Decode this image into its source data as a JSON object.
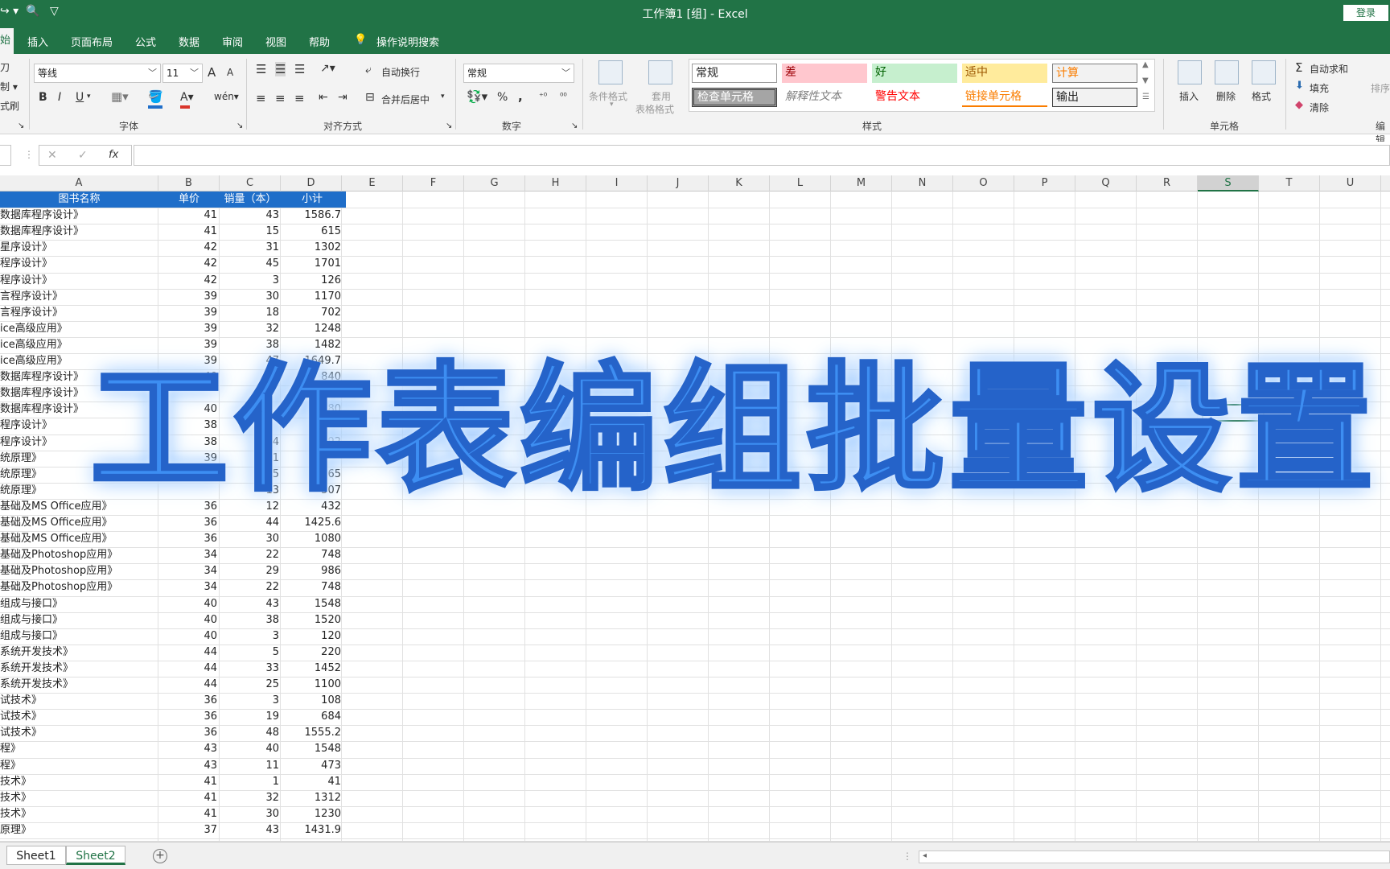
{
  "titlebar": {
    "title": "工作簿1  [组]  -  Excel",
    "login": "登录",
    "qat": [
      "↪ ▾",
      "🔍",
      "▽"
    ]
  },
  "tabs": {
    "home": "始",
    "items": [
      "插入",
      "页面布局",
      "公式",
      "数据",
      "审阅",
      "视图",
      "帮助"
    ],
    "search": "操作说明搜索"
  },
  "ribbon": {
    "clipboard": [
      "刀",
      "制 ▾",
      "式刷"
    ],
    "font": {
      "name": "等线",
      "size": "11",
      "grow": "A",
      "shrink": "A",
      "bold": "B",
      "italic": "I",
      "underline": "U",
      "label": "字体"
    },
    "alignment": {
      "wrap": "自动换行",
      "merge": "合并后居中",
      "label": "对齐方式"
    },
    "number": {
      "format": "常规",
      "percent": "%",
      "comma": ",",
      "label": "数字"
    },
    "conditional": "条件格式",
    "table_format_1": "套用",
    "table_format_2": "表格格式",
    "styles": {
      "normal": "常规",
      "bad": "差",
      "good": "好",
      "neutral": "适中",
      "calc": "计算",
      "check": "检查单元格",
      "explain": "解释性文本",
      "warn": "警告文本",
      "link": "链接单元格",
      "output": "输出",
      "label": "样式"
    },
    "cells": {
      "insert": "插入",
      "delete": "删除",
      "format": "格式",
      "label": "单元格"
    },
    "editing": {
      "autosum": "自动求和",
      "fill": "填充",
      "clear": "清除",
      "sort": "排序",
      "label": "编辑"
    }
  },
  "formula": {
    "cancel": "✕",
    "enter": "✓",
    "fx": "fx"
  },
  "columns": [
    "A",
    "B",
    "C",
    "D",
    "E",
    "F",
    "G",
    "H",
    "I",
    "J",
    "K",
    "L",
    "M",
    "N",
    "O",
    "P",
    "Q",
    "R",
    "S",
    "T",
    "U"
  ],
  "table": {
    "header": [
      "图书名称",
      "单价",
      "销量（本）",
      "小计"
    ],
    "rows": [
      [
        "数据库程序设计》",
        "41",
        "43",
        "1586.7"
      ],
      [
        "数据库程序设计》",
        "41",
        "15",
        "615"
      ],
      [
        "星序设计》",
        "42",
        "31",
        "1302"
      ],
      [
        "程序设计》",
        "42",
        "45",
        "1701"
      ],
      [
        "程序设计》",
        "42",
        "3",
        "126"
      ],
      [
        "言程序设计》",
        "39",
        "30",
        "1170"
      ],
      [
        "言程序设计》",
        "39",
        "18",
        "702"
      ],
      [
        "ice高级应用》",
        "39",
        "32",
        "1248"
      ],
      [
        "ice高级应用》",
        "39",
        "38",
        "1482"
      ],
      [
        "ice高级应用》",
        "39",
        "47",
        "1649.7"
      ],
      [
        "数据库程序设计》",
        "40",
        "1",
        "840"
      ],
      [
        "数据库程序设计》",
        "",
        "",
        ""
      ],
      [
        "数据库程序设计》",
        "40",
        "",
        "880"
      ],
      [
        "程序设计》",
        "38",
        "",
        ""
      ],
      [
        "程序设计》",
        "38",
        "34",
        "1292"
      ],
      [
        "统原理》",
        "39",
        "41",
        ""
      ],
      [
        "统原理》",
        "",
        "35",
        "1365"
      ],
      [
        "统原理》",
        "",
        "13",
        "507"
      ],
      [
        "基础及MS Office应用》",
        "36",
        "12",
        "432"
      ],
      [
        "基础及MS Office应用》",
        "36",
        "44",
        "1425.6"
      ],
      [
        "基础及MS Office应用》",
        "36",
        "30",
        "1080"
      ],
      [
        "基础及Photoshop应用》",
        "34",
        "22",
        "748"
      ],
      [
        "基础及Photoshop应用》",
        "34",
        "29",
        "986"
      ],
      [
        "基础及Photoshop应用》",
        "34",
        "22",
        "748"
      ],
      [
        "组成与接口》",
        "40",
        "43",
        "1548"
      ],
      [
        "组成与接口》",
        "40",
        "38",
        "1520"
      ],
      [
        "组成与接口》",
        "40",
        "3",
        "120"
      ],
      [
        "系统开发技术》",
        "44",
        "5",
        "220"
      ],
      [
        "系统开发技术》",
        "44",
        "33",
        "1452"
      ],
      [
        "系统开发技术》",
        "44",
        "25",
        "1100"
      ],
      [
        "试技术》",
        "36",
        "3",
        "108"
      ],
      [
        "试技术》",
        "36",
        "19",
        "684"
      ],
      [
        "试技术》",
        "36",
        "48",
        "1555.2"
      ],
      [
        "程》",
        "43",
        "40",
        "1548"
      ],
      [
        "程》",
        "43",
        "11",
        "473"
      ],
      [
        "技术》",
        "41",
        "1",
        "41"
      ],
      [
        "技术》",
        "41",
        "32",
        "1312"
      ],
      [
        "技术》",
        "41",
        "30",
        "1230"
      ],
      [
        "原理》",
        "37",
        "43",
        "1431.9"
      ]
    ]
  },
  "overlay": {
    "text": "工作表编组批量设置"
  },
  "sheets": [
    "Sheet1",
    "Sheet2"
  ],
  "colors": {
    "excel_green": "#217346",
    "header_blue": "#1f6ec9",
    "overlay_blue": "#3d8ef2"
  }
}
